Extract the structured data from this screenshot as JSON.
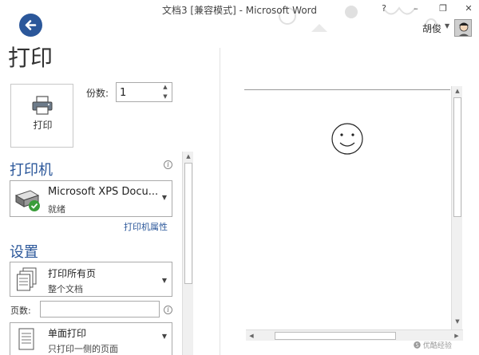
{
  "window": {
    "title": "文档3 [兼容模式] - Microsoft Word",
    "help": "?",
    "minimize": "–",
    "restore": "❐",
    "close": "✕"
  },
  "header": {
    "back_icon": "arrow-left-icon",
    "page_title": "打印",
    "user_name": "胡俊",
    "user_caret": "▼"
  },
  "print_button": {
    "label": "打印",
    "icon": "printer-icon"
  },
  "copies": {
    "label": "份数:",
    "value": "1"
  },
  "printer": {
    "section_title": "打印机",
    "name": "Microsoft XPS Docu...",
    "status": "就绪",
    "properties_link": "打印机属性"
  },
  "settings": {
    "section_title": "设置",
    "print_range": {
      "title": "打印所有页",
      "sub": "整个文档"
    },
    "pages_label": "页数:",
    "pages_value": "",
    "sides": {
      "title": "单面打印",
      "sub": "只打印一侧的页面"
    }
  },
  "watermark": "🅢 优酷经验"
}
